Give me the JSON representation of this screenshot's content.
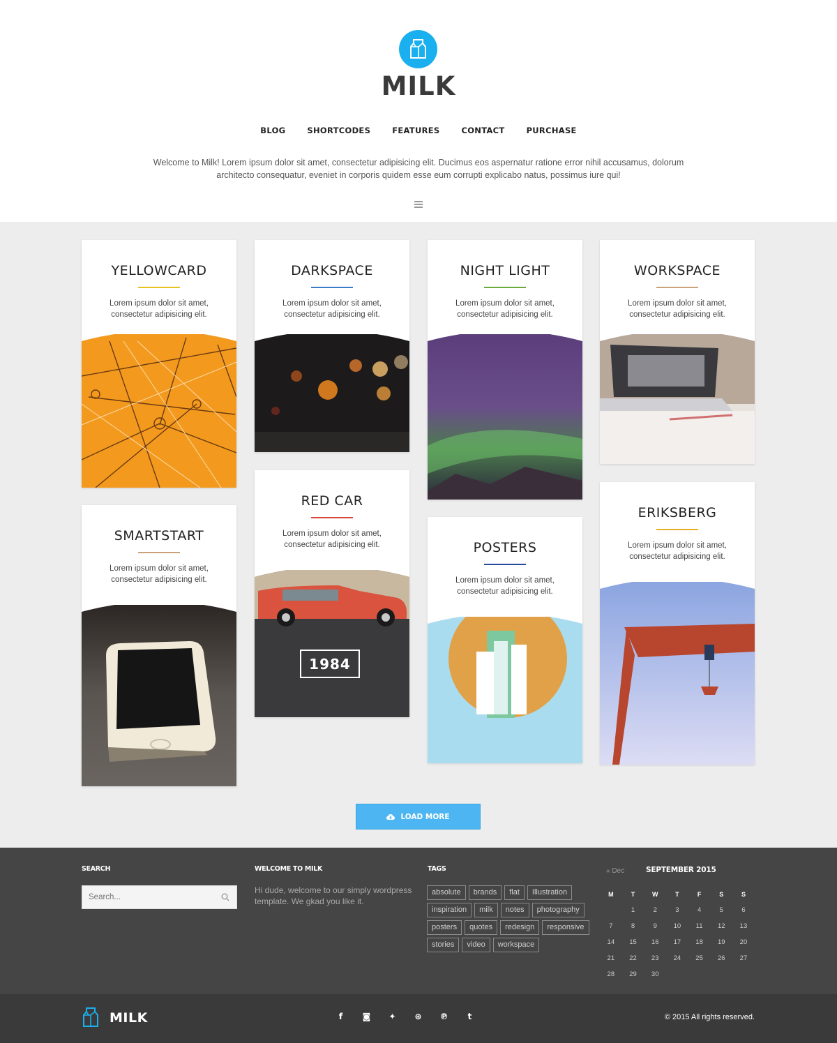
{
  "brand": {
    "name": "MILK",
    "logo_icon": "milk-carton-icon",
    "accent": "#1ab0f0"
  },
  "nav": {
    "items": [
      "BLOG",
      "SHORTCODES",
      "FEATURES",
      "CONTACT",
      "PURCHASE"
    ]
  },
  "intro": {
    "line1": "Welcome to Milk! Lorem ipsum dolor sit amet, consectetur adipisicing elit. Ducimus eos aspernatur ratione error nihil accusamus, dolorum",
    "line2": "architecto consequatur, eveniet in corporis quidem esse eum corrupti explicabo natus, possimus iure qui!"
  },
  "cards": [
    {
      "title": "YELLOWCARD",
      "line1": "Lorem ipsum dolor sit amet,",
      "line2": "consectetur adipisicing elit.",
      "accent": "#e3c41e"
    },
    {
      "title": "DARKSPACE",
      "line1": "Lorem ipsum dolor sit amet,",
      "line2": "consectetur adipisicing elit.",
      "accent": "#3a7cc9"
    },
    {
      "title": "NIGHT LIGHT",
      "line1": "Lorem ipsum dolor sit amet,",
      "line2": "consectetur adipisicing elit.",
      "accent": "#6aaa3a"
    },
    {
      "title": "WORKSPACE",
      "line1": "Lorem ipsum dolor sit amet,",
      "line2": "consectetur adipisicing elit.",
      "accent": "#c9a27c"
    },
    {
      "title": "SMARTSTART",
      "line1": "Lorem ipsum dolor sit amet,",
      "line2": "consectetur adipisicing elit.",
      "accent": "#c9a27c"
    },
    {
      "title": "RED CAR",
      "line1": "Lorem ipsum dolor sit amet,",
      "line2": "consectetur adipisicing elit.",
      "accent": "#d9453a",
      "badge": "1984"
    },
    {
      "title": "POSTERS",
      "line1": "Lorem ipsum dolor sit amet,",
      "line2": "consectetur adipisicing elit.",
      "accent": "#2a4aa0"
    },
    {
      "title": "ERIKSBERG",
      "line1": "Lorem ipsum dolor sit amet,",
      "line2": "consectetur adipisicing elit.",
      "accent": "#e8b020"
    }
  ],
  "load_more": {
    "label": "LOAD MORE",
    "icon": "cloud-download-icon"
  },
  "footer": {
    "search": {
      "heading": "SEARCH",
      "placeholder": "Search..."
    },
    "welcome": {
      "heading": "WELCOME TO MILK",
      "text": "Hi dude, welcome to our simply wordpress template. We gkad you like it."
    },
    "tags": {
      "heading": "TAGS",
      "items": [
        "absolute",
        "brands",
        "flat",
        "Illustration",
        "inspiration",
        "milk",
        "notes",
        "photography",
        "posters",
        "quotes",
        "redesign",
        "responsive",
        "stories",
        "video",
        "workspace"
      ]
    },
    "calendar": {
      "prev": "« Dec",
      "title": "SEPTEMBER 2015",
      "days": [
        "M",
        "T",
        "W",
        "T",
        "F",
        "S",
        "S"
      ],
      "weeks": [
        [
          "",
          "1",
          "2",
          "3",
          "4",
          "5",
          "6"
        ],
        [
          "7",
          "8",
          "9",
          "10",
          "11",
          "12",
          "13"
        ],
        [
          "14",
          "15",
          "16",
          "17",
          "18",
          "19",
          "20"
        ],
        [
          "21",
          "22",
          "23",
          "24",
          "25",
          "26",
          "27"
        ],
        [
          "28",
          "29",
          "30",
          "",
          "",
          "",
          ""
        ]
      ]
    }
  },
  "bottom": {
    "brand": "MILK",
    "social": [
      "facebook-icon",
      "instagram-icon",
      "twitter-icon",
      "dribbble-icon",
      "pinterest-icon",
      "tumblr-icon"
    ],
    "copyright": "© 2015 All rights reserved."
  }
}
